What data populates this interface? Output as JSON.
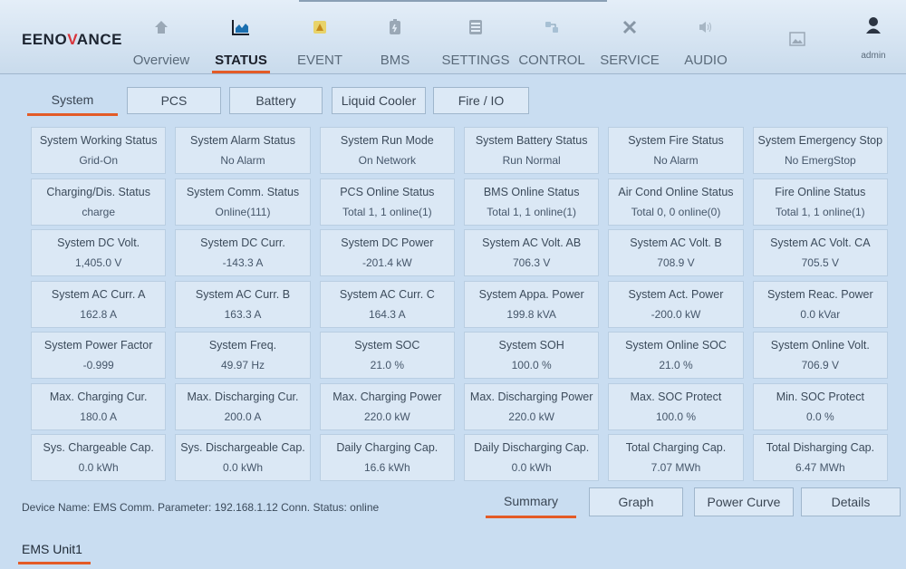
{
  "brand": {
    "logo_text_a": "EENO",
    "logo_text_b": "V",
    "logo_text_c": "ANCE"
  },
  "accent": "#e35b27",
  "nav": [
    {
      "label": "Overview",
      "icon": "home-icon"
    },
    {
      "label": "STATUS",
      "icon": "chart-icon",
      "active": true
    },
    {
      "label": "EVENT",
      "icon": "alert-icon"
    },
    {
      "label": "BMS",
      "icon": "battery-icon"
    },
    {
      "label": "SETTINGS",
      "icon": "settings-icon"
    },
    {
      "label": "CONTROL",
      "icon": "control-icon"
    },
    {
      "label": "SERVICE",
      "icon": "tools-icon"
    },
    {
      "label": "AUDIO",
      "icon": "speaker-icon"
    }
  ],
  "user": {
    "label": "admin"
  },
  "subtabs": [
    "System",
    "PCS",
    "Battery",
    "Liquid Cooler",
    "Fire / IO"
  ],
  "cells": [
    {
      "label": "System Working Status",
      "value": "Grid-On"
    },
    {
      "label": "System Alarm Status",
      "value": "No Alarm"
    },
    {
      "label": "System Run Mode",
      "value": "On Network"
    },
    {
      "label": "System Battery Status",
      "value": "Run Normal"
    },
    {
      "label": "System Fire Status",
      "value": "No Alarm"
    },
    {
      "label": "System Emergency Stop",
      "value": "No EmergStop"
    },
    {
      "label": "Charging/Dis. Status",
      "value": "charge"
    },
    {
      "label": "System Comm. Status",
      "value": "Online(111)"
    },
    {
      "label": "PCS Online Status",
      "value": "Total 1, 1 online(1)"
    },
    {
      "label": "BMS Online Status",
      "value": "Total 1, 1 online(1)"
    },
    {
      "label": "Air Cond Online Status",
      "value": "Total 0, 0 online(0)"
    },
    {
      "label": "Fire Online Status",
      "value": "Total 1, 1 online(1)"
    },
    {
      "label": "System DC Volt.",
      "value": "1,405.0 V"
    },
    {
      "label": "System DC Curr.",
      "value": "-143.3 A"
    },
    {
      "label": "System DC Power",
      "value": "-201.4 kW"
    },
    {
      "label": "System AC Volt. AB",
      "value": "706.3 V"
    },
    {
      "label": "System AC Volt. B",
      "value": "708.9 V"
    },
    {
      "label": "System AC Volt. CA",
      "value": "705.5 V"
    },
    {
      "label": "System AC Curr. A",
      "value": "162.8 A"
    },
    {
      "label": "System AC Curr. B",
      "value": "163.3 A"
    },
    {
      "label": "System AC Curr. C",
      "value": "164.3 A"
    },
    {
      "label": "System Appa. Power",
      "value": "199.8 kVA"
    },
    {
      "label": "System Act. Power",
      "value": "-200.0 kW"
    },
    {
      "label": "System Reac. Power",
      "value": "0.0 kVar"
    },
    {
      "label": "System Power Factor",
      "value": "-0.999"
    },
    {
      "label": "System Freq.",
      "value": "49.97 Hz"
    },
    {
      "label": "System SOC",
      "value": "21.0 %"
    },
    {
      "label": "System SOH",
      "value": "100.0 %"
    },
    {
      "label": "System Online SOC",
      "value": "21.0 %"
    },
    {
      "label": "System Online Volt.",
      "value": "706.9 V"
    },
    {
      "label": "Max. Charging Cur.",
      "value": "180.0 A"
    },
    {
      "label": "Max. Discharging Cur.",
      "value": "200.0 A"
    },
    {
      "label": "Max. Charging Power",
      "value": "220.0 kW"
    },
    {
      "label": "Max. Discharging Power",
      "value": "220.0 kW"
    },
    {
      "label": "Max. SOC Protect",
      "value": "100.0 %"
    },
    {
      "label": "Min. SOC Protect",
      "value": "0.0 %"
    },
    {
      "label": "Sys. Chargeable Cap.",
      "value": "0.0 kWh"
    },
    {
      "label": "Sys. Dischargeable Cap.",
      "value": "0.0 kWh"
    },
    {
      "label": "Daily Charging Cap.",
      "value": "16.6 kWh"
    },
    {
      "label": "Daily Discharging Cap.",
      "value": "0.0 kWh"
    },
    {
      "label": "Total Charging Cap.",
      "value": "7.07 MWh"
    },
    {
      "label": "Total Disharging Cap.",
      "value": "6.47 MWh"
    }
  ],
  "device_info": "Device Name:  EMS  Comm. Parameter:  192.168.1.12  Conn. Status:  online",
  "bottom_tabs": [
    "Summary",
    "Graph",
    "Power Curve",
    "Details"
  ],
  "unit_tab": "EMS Unit1"
}
